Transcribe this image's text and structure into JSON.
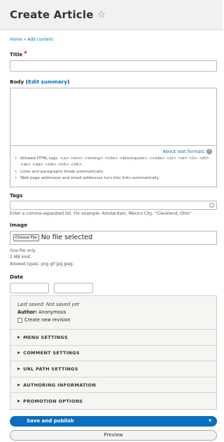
{
  "header": {
    "title": "Create Article",
    "star_icon": "star-outline-icon"
  },
  "breadcrumb": {
    "home": "Home",
    "sep": " » ",
    "current": "Add content"
  },
  "title_field": {
    "label": "Title",
    "required_mark": "*",
    "value": ""
  },
  "body_field": {
    "label": "Body",
    "edit_summary_prefix": " (",
    "edit_summary": "Edit summary",
    "edit_summary_suffix": ")",
    "value": "",
    "about_formats": "About text formats",
    "help_icon": "?",
    "tips": [
      "Allowed HTML tags: <a> <em> <strong> <cite> <blockquote> <code> <ul> <ol> <li> <dl> <dt> <dd> <h4> <h5> <h6>",
      "Lines and paragraphs break automatically.",
      "Web page addresses and email addresses turn into links automatically."
    ]
  },
  "tags_field": {
    "label": "Tags",
    "value": "",
    "hint": "Enter a comma-separated list. For example: Amsterdam, Mexico City, \"Cleveland, Ohio\""
  },
  "image_field": {
    "label": "Image",
    "choose_button": "Choose File",
    "no_file": "No file selected",
    "desc": [
      "One file only.",
      "2 MB limit.",
      "Allowed types: png gif jpg jpeg."
    ]
  },
  "date_field": {
    "label": "Date",
    "date_value": "",
    "time_value": ""
  },
  "meta": {
    "last_saved": "Last saved: Not saved yet",
    "author_label": "Author:",
    "author_value": " Anonymous",
    "revision_label": "Create new revision",
    "revision_checked": false
  },
  "details": [
    "MENU SETTINGS",
    "COMMENT SETTINGS",
    "URL PATH SETTINGS",
    "AUTHORING INFORMATION",
    "PROMOTION OPTIONS"
  ],
  "actions": {
    "save": "Save and publish",
    "preview": "Preview"
  },
  "colors": {
    "accent": "#0a6fbf",
    "link": "#0074bd",
    "required": "#e00000",
    "header_bg": "#f1f1ef"
  }
}
